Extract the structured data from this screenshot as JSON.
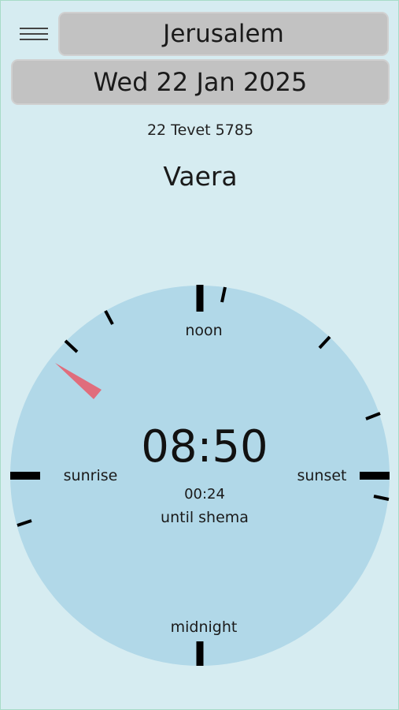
{
  "header": {
    "menu_icon": "hamburger-menu-icon",
    "location": "Jerusalem",
    "date": "Wed 22 Jan 2025"
  },
  "hebrew_date": "22 Tevet 5785",
  "parsha": "Vaera",
  "dial": {
    "labels": {
      "top": "noon",
      "left": "sunrise",
      "right": "sunset",
      "bottom": "midnight"
    },
    "time": "08:50",
    "countdown": "00:24",
    "countdown_label": "until shema",
    "colors": {
      "face": "#b1d8e8",
      "hand": "#e06d7c",
      "ticks": "#000000"
    }
  }
}
